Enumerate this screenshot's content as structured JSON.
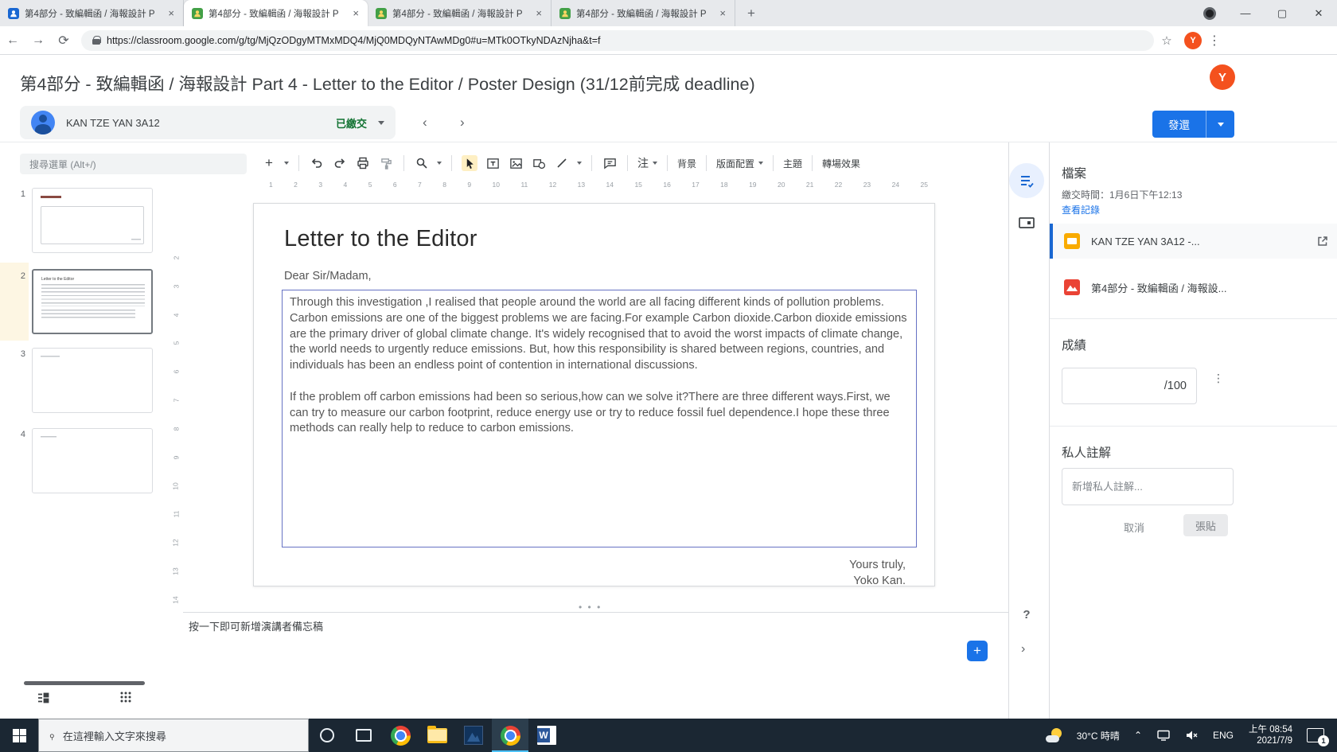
{
  "browser": {
    "tabs": [
      {
        "title": "第4部分 - 致編輯函 / 海報設計 P",
        "close": "×"
      },
      {
        "title": "第4部分 - 致編輯函 / 海報設計 P",
        "close": "×"
      },
      {
        "title": "第4部分 - 致編輯函 / 海報設計 P",
        "close": "×"
      },
      {
        "title": "第4部分 - 致編輯函 / 海報設計 P",
        "close": "×"
      }
    ],
    "new_tab_label": "+",
    "url": "https://classroom.google.com/g/tg/MjQzODgyMTMxMDQ4/MjQ0MDQyNTAwMDg0#u=MTk0OTkyNDAzNjha&t=f",
    "avatar_initial": "Y",
    "window_controls": {
      "minimize": "—",
      "maximize": "▢",
      "close": "✕"
    }
  },
  "header": {
    "title": "第4部分 - 致編輯函 / 海報設計 Part 4 - Letter to the Editor / Poster Design (31/12前完成 deadline)",
    "avatar_initial": "Y"
  },
  "student_bar": {
    "name": "KAN TZE YAN 3A12",
    "status": "已繳交",
    "prev": "‹",
    "next": "›",
    "return_label": "發還"
  },
  "editor": {
    "search_placeholder": "搜尋選單 (Alt+/)",
    "toolbar": {
      "annotate_label": "注",
      "background_label": "背景",
      "layout_label": "版面配置",
      "theme_label": "主題",
      "transition_label": "轉場效果"
    },
    "ruler_h": [
      "1",
      "2",
      "3",
      "4",
      "5",
      "6",
      "7",
      "8",
      "9",
      "10",
      "11",
      "12",
      "13",
      "14",
      "15",
      "16",
      "17",
      "18",
      "19",
      "20",
      "21",
      "22",
      "23",
      "24",
      "25"
    ],
    "ruler_v": [
      "2",
      "3",
      "4",
      "5",
      "6",
      "7",
      "8",
      "9",
      "10",
      "11",
      "12",
      "13",
      "14"
    ],
    "slides": [
      {
        "num": "1"
      },
      {
        "num": "2",
        "title": "Letter to the Editor",
        "selected": true
      },
      {
        "num": "3"
      },
      {
        "num": "4"
      }
    ],
    "notes_placeholder": "按一下即可新增演講者備忘稿",
    "more_handle": "• • •"
  },
  "letter": {
    "title": "Letter to the Editor",
    "salutation": "Dear Sir/Madam,",
    "para1": "Through this investigation ,I realised that people around the world are all facing different kinds of pollution problems. Carbon emissions are one of the biggest problems we are facing.For example Carbon dioxide.Carbon dioxide emissions are the primary driver of global climate change. It's widely recognised that to avoid the worst impacts of climate change, the world needs to urgently reduce emissions. But, how this responsibility is shared between regions, countries, and individuals has been an endless point of contention in international discussions.",
    "para2": "If the problem off carbon emissions had been so serious,how can we solve it?There are three different ways.First, we can try to measure our carbon footprint, reduce energy use or try to reduce fossil fuel dependence.I hope these three methods can really help to reduce to carbon emissions.",
    "closing_1": "Yours truly,",
    "closing_2": "Yoko Kan."
  },
  "right_panel": {
    "files_heading": "檔案",
    "submitted_time": "繳交時間：1月6日下午12:13",
    "view_history": "查看記錄",
    "files": [
      {
        "name": "KAN TZE YAN 3A12 -...",
        "type": "slides"
      },
      {
        "name": "第4部分 - 致編輯函 / 海報設...",
        "type": "image"
      }
    ],
    "grade_heading": "成績",
    "grade_denominator": "/100",
    "private_comment_heading": "私人註解",
    "private_comment_placeholder": "新增私人註解...",
    "cancel_label": "取消",
    "post_label": "張貼"
  },
  "taskbar": {
    "search_placeholder": "在這裡輸入文字來搜尋",
    "weather": "30°C 時晴",
    "language": "ENG",
    "time": "上午 08:54",
    "date": "2021/7/9",
    "notification_count": "1"
  },
  "colors": {
    "accent_blue": "#1a73e8",
    "submitted_green": "#137333",
    "textbox_border": "#6672c4",
    "taskbar_bg": "#1b2733"
  }
}
